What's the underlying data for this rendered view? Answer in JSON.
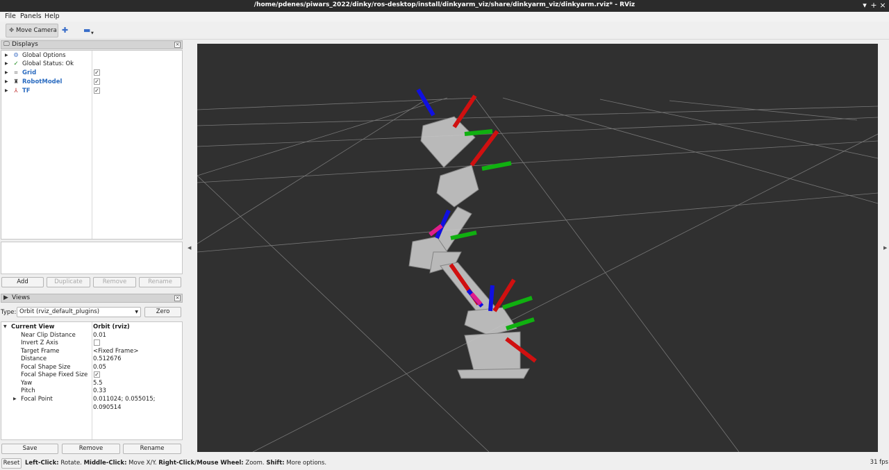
{
  "window": {
    "title": "/home/pdenes/piwars_2022/dinky/ros-desktop/install/dinkyarm_viz/share/dinkyarm_viz/dinkyarm.rviz* - RViz",
    "minimize": "▾",
    "maximize": "+",
    "close": "×"
  },
  "menu": {
    "file": "File",
    "panels": "Panels",
    "help": "Help"
  },
  "toolbar": {
    "move_camera": "Move Camera"
  },
  "displays": {
    "title": "Displays",
    "items": [
      {
        "label": "Global Options",
        "icon": "gear-icon",
        "checked": null
      },
      {
        "label": "Global Status: Ok",
        "icon": "checkmark-icon",
        "checked": null
      },
      {
        "label": "Grid",
        "icon": "grid-icon",
        "checked": true
      },
      {
        "label": "RobotModel",
        "icon": "robot-icon",
        "checked": true
      },
      {
        "label": "TF",
        "icon": "axes-icon",
        "checked": true
      }
    ],
    "buttons": {
      "add": "Add",
      "duplicate": "Duplicate",
      "remove": "Remove",
      "rename": "Rename"
    }
  },
  "views": {
    "title": "Views",
    "type_label": "Type:",
    "type_value": "Orbit (rviz_default_plugins)",
    "zero": "Zero",
    "current_view": {
      "label": "Current View",
      "value": "Orbit (rviz)"
    },
    "properties": [
      {
        "label": "Near Clip Distance",
        "value": "0.01"
      },
      {
        "label": "Invert Z Axis",
        "value": "",
        "checkbox": false
      },
      {
        "label": "Target Frame",
        "value": "<Fixed Frame>"
      },
      {
        "label": "Distance",
        "value": "0.512676"
      },
      {
        "label": "Focal Shape Size",
        "value": "0.05"
      },
      {
        "label": "Focal Shape Fixed Size",
        "value": "",
        "checkbox": true
      },
      {
        "label": "Yaw",
        "value": "5.5"
      },
      {
        "label": "Pitch",
        "value": "0.33"
      },
      {
        "label": "Focal Point",
        "value": "0.011024; 0.055015; 0.090514"
      }
    ],
    "buttons": {
      "save": "Save",
      "remove": "Remove",
      "rename": "Rename"
    }
  },
  "status": {
    "reset": "Reset",
    "hint_parts": [
      {
        "text": "Left-Click:",
        "bold": true
      },
      {
        "text": " Rotate. ",
        "bold": false
      },
      {
        "text": "Middle-Click:",
        "bold": true
      },
      {
        "text": " Move X/Y. ",
        "bold": false
      },
      {
        "text": "Right-Click/Mouse Wheel:",
        "bold": true
      },
      {
        "text": " Zoom. ",
        "bold": false
      },
      {
        "text": "Shift:",
        "bold": true
      },
      {
        "text": " More options.",
        "bold": false
      }
    ],
    "fps": "31 fps"
  },
  "colors": {
    "viewport_bg": "#303030",
    "grid_line": "#a0a0a0",
    "axis_x": "#d01010",
    "axis_y": "#10b010",
    "axis_z": "#1010e0",
    "link_blue": "#2a6bc0"
  }
}
